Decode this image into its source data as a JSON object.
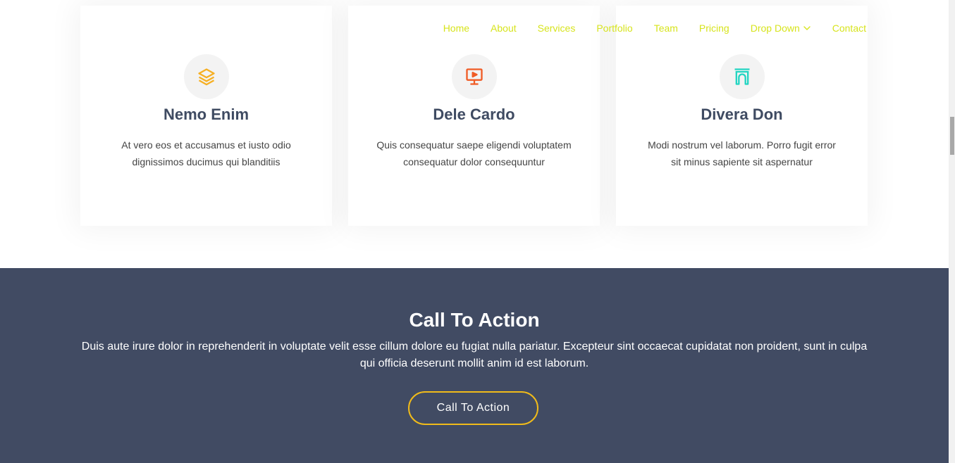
{
  "nav": {
    "items": [
      {
        "label": "Home"
      },
      {
        "label": "About"
      },
      {
        "label": "Services"
      },
      {
        "label": "Portfolio"
      },
      {
        "label": "Team"
      },
      {
        "label": "Pricing"
      },
      {
        "label": "Drop Down"
      },
      {
        "label": "Contact"
      }
    ],
    "color": "#d7e41d"
  },
  "services": {
    "cards": [
      {
        "icon": "layers-icon",
        "icon_color": "#f6b024",
        "title": "Nemo Enim",
        "text": "At vero eos et accusamus et iusto odio dignissimos ducimus qui blanditiis"
      },
      {
        "icon": "presentation-play-icon",
        "icon_color": "#f05c26",
        "title": "Dele Cardo",
        "text": "Quis consequatur saepe eligendi voluptatem consequatur dolor consequuntur"
      },
      {
        "icon": "arch-icon",
        "icon_color": "#22d5c2",
        "title": "Divera Don",
        "text": "Modi nostrum vel laborum. Porro fugit error sit minus sapiente sit aspernatur"
      }
    ]
  },
  "cta": {
    "title": "Call To Action",
    "text": "Duis aute irure dolor in reprehenderit in voluptate velit esse cillum dolore eu fugiat nulla pariatur. Excepteur sint occaecat cupidatat non proident, sunt in culpa qui officia deserunt mollit anim id est laborum.",
    "button_label": "Call To Action",
    "background": "#414b63",
    "button_border": "#f0bb1a"
  }
}
